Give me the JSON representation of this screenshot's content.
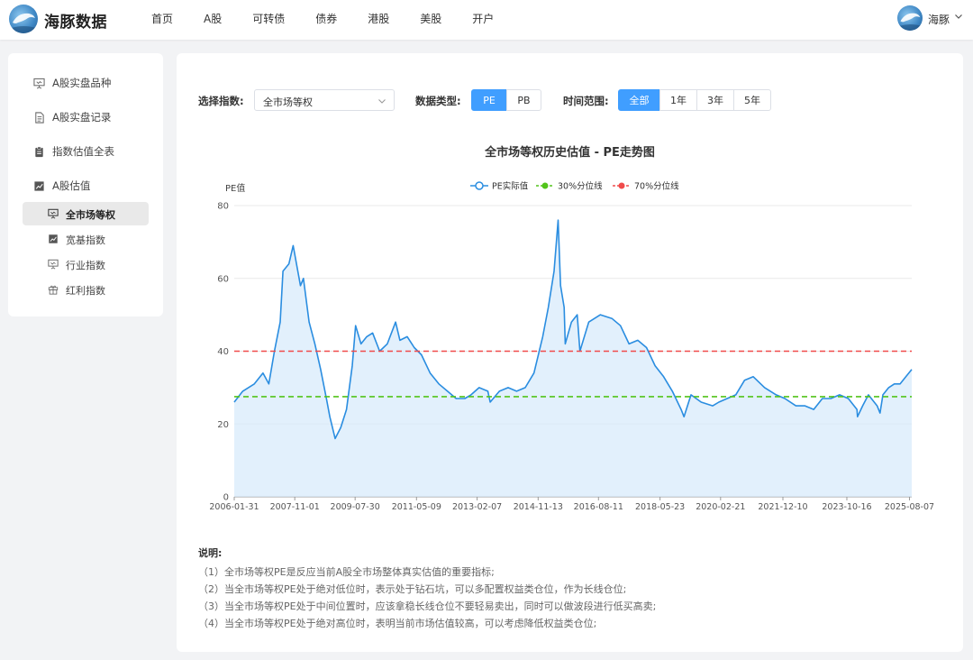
{
  "brand": {
    "name": "海豚数据"
  },
  "nav": [
    "首页",
    "A股",
    "可转债",
    "债券",
    "港股",
    "美股",
    "开户"
  ],
  "user": {
    "name": "海豚"
  },
  "sidebar": {
    "items": [
      {
        "label": "A股实盘品种",
        "icon": "presentation-icon"
      },
      {
        "label": "A股实盘记录",
        "icon": "document-icon"
      },
      {
        "label": "指数估值全表",
        "icon": "clipboard-icon"
      },
      {
        "label": "A股估值",
        "icon": "chart-icon"
      }
    ],
    "subitems": [
      {
        "label": "全市场等权",
        "icon": "presentation-icon",
        "active": true
      },
      {
        "label": "宽基指数",
        "icon": "chart-icon",
        "active": false
      },
      {
        "label": "行业指数",
        "icon": "presentation-icon",
        "active": false
      },
      {
        "label": "红利指数",
        "icon": "gift-icon",
        "active": false
      }
    ]
  },
  "filters": {
    "index_label": "选择指数:",
    "index_value": "全市场等权",
    "type_label": "数据类型:",
    "types": [
      "PE",
      "PB"
    ],
    "type_selected": "PE",
    "range_label": "时间范围:",
    "ranges": [
      "全部",
      "1年",
      "3年",
      "5年"
    ],
    "range_selected": "全部"
  },
  "colors": {
    "accent": "#409eff",
    "pe_line": "#2a8de0",
    "p30": "#52c41a",
    "p70": "#f04b4b"
  },
  "chart_data": {
    "type": "line",
    "title": "全市场等权历史估值 - PE走势图",
    "ylabel": "PE值",
    "ylim": [
      0,
      80
    ],
    "yticks": [
      0,
      20,
      40,
      60,
      80
    ],
    "x_range": [
      "2006-01-31",
      "2025-08-31"
    ],
    "xticks": [
      "2006-01-31",
      "2007-11-01",
      "2009-07-30",
      "2011-05-09",
      "2013-02-07",
      "2014-11-13",
      "2016-08-11",
      "2018-05-23",
      "2020-02-21",
      "2021-12-10",
      "2023-10-16",
      "2025-08-07"
    ],
    "legend_position": "top-center",
    "grid": true,
    "series": [
      {
        "name": "PE实际值",
        "x": [
          "2006-01-31",
          "2006-04-30",
          "2006-08-31",
          "2006-11-30",
          "2007-01-31",
          "2007-03-31",
          "2007-05-31",
          "2007-06-30",
          "2007-08-31",
          "2007-10-15",
          "2007-12-31",
          "2008-01-31",
          "2008-03-31",
          "2008-05-31",
          "2008-07-31",
          "2008-09-30",
          "2008-11-05",
          "2008-12-31",
          "2009-02-28",
          "2009-04-30",
          "2009-06-30",
          "2009-08-04",
          "2009-09-30",
          "2009-11-30",
          "2010-01-31",
          "2010-04-15",
          "2010-07-05",
          "2010-09-30",
          "2010-11-15",
          "2011-01-31",
          "2011-04-15",
          "2011-06-30",
          "2011-09-30",
          "2011-12-31",
          "2012-03-31",
          "2012-06-30",
          "2012-09-30",
          "2012-12-04",
          "2013-02-28",
          "2013-05-31",
          "2013-06-25",
          "2013-09-30",
          "2013-12-31",
          "2014-03-31",
          "2014-06-30",
          "2014-09-30",
          "2014-12-31",
          "2015-02-28",
          "2015-04-30",
          "2015-06-12",
          "2015-07-08",
          "2015-08-15",
          "2015-08-26",
          "2015-10-31",
          "2015-12-31",
          "2016-01-28",
          "2016-04-30",
          "2016-08-31",
          "2016-12-31",
          "2017-03-31",
          "2017-06-30",
          "2017-09-30",
          "2017-12-31",
          "2018-03-31",
          "2018-06-30",
          "2018-09-30",
          "2018-12-31",
          "2019-01-31",
          "2019-04-15",
          "2019-07-31",
          "2019-11-30",
          "2020-02-03",
          "2020-04-30",
          "2020-07-31",
          "2020-10-31",
          "2021-01-31",
          "2021-05-31",
          "2021-09-30",
          "2021-12-31",
          "2022-04-26",
          "2022-07-31",
          "2022-10-31",
          "2023-01-31",
          "2023-04-30",
          "2023-07-31",
          "2023-10-31",
          "2024-01-31",
          "2024-02-05",
          "2024-03-31",
          "2024-05-31",
          "2024-08-31",
          "2024-09-30",
          "2024-10-31",
          "2024-12-31",
          "2025-02-28",
          "2025-04-30",
          "2025-06-30",
          "2025-08-31"
        ],
        "values": [
          26,
          29,
          31,
          34,
          31,
          40,
          48,
          62,
          64,
          69,
          58,
          60,
          48,
          42,
          35,
          27,
          22,
          16,
          19,
          24,
          36,
          47,
          42,
          44,
          45,
          40,
          42,
          48,
          43,
          44,
          41,
          39,
          34,
          31,
          29,
          27,
          27,
          28,
          30,
          29,
          26,
          29,
          30,
          29,
          30,
          34,
          44,
          52,
          62,
          76,
          58,
          52,
          42,
          48,
          50,
          40,
          48,
          50,
          49,
          47,
          42,
          43,
          41,
          36,
          33,
          29,
          24,
          22,
          28,
          26,
          25,
          26,
          27,
          28,
          32,
          33,
          30,
          28,
          27,
          25,
          25,
          24,
          27,
          27,
          28,
          27,
          24,
          22,
          25,
          28,
          25,
          23,
          28,
          30,
          31,
          31,
          33,
          35
        ]
      },
      {
        "name": "30%分位线",
        "values": [
          27.5
        ]
      },
      {
        "name": "70%分位线",
        "values": [
          40
        ]
      }
    ]
  },
  "notes": {
    "title": "说明:",
    "lines": [
      "（1）全市场等权PE是反应当前A股全市场整体真实估值的重要指标;",
      "（2）当全市场等权PE处于绝对低位时，表示处于钻石坑，可以多配置权益类仓位，作为长线仓位;",
      "（3）当全市场等权PE处于中间位置时，应该拿稳长线仓位不要轻易卖出，同时可以做波段进行低买高卖;",
      "（4）当全市场等权PE处于绝对高位时，表明当前市场估值较高，可以考虑降低权益类仓位;"
    ]
  }
}
